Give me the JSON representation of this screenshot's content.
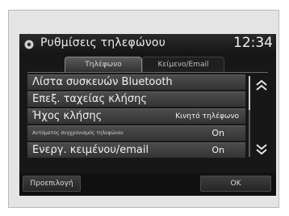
{
  "header": {
    "icon": "phone-settings-icon",
    "title": "Ρυθμίσεις τηλεφώνου",
    "clock": "12:34"
  },
  "tabs": [
    {
      "label": "Τηλέφωνο",
      "selected": true
    },
    {
      "label": "Κείμενο/Email",
      "selected": false
    }
  ],
  "list": {
    "items": [
      {
        "label": "Λίστα συσκευών Bluetooth",
        "value": ""
      },
      {
        "label": "Επεξ. ταχείας κλήσης",
        "value": ""
      },
      {
        "label": "Ήχος κλήσης",
        "value": "Κινητό τηλέφωνο"
      },
      {
        "label": "Αυτόματος συγχρονισμός τηλεφώνου",
        "value": "On"
      },
      {
        "label": "Ενεργ. κειμένου/email",
        "value": "On"
      }
    ],
    "scroll_up_icon": "double-chevron-up-icon",
    "scroll_down_icon": "double-chevron-down-icon"
  },
  "footer": {
    "default_label": "Προεπιλογή",
    "ok_label": "OK"
  }
}
